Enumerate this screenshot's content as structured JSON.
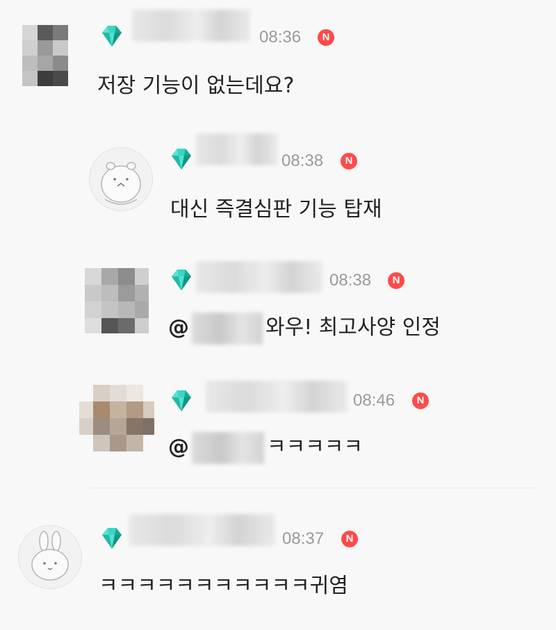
{
  "comments": [
    {
      "time": "08:36",
      "badge": "N",
      "text": "저장 기능이 없는데요?"
    },
    {
      "time": "08:38",
      "badge": "N",
      "text": "대신 즉결심판 기능 탑재"
    },
    {
      "time": "08:38",
      "badge": "N",
      "mention_prefix": "@",
      "text": "와우! 최고사양 인정"
    },
    {
      "time": "08:46",
      "badge": "N",
      "mention_prefix": "@",
      "text": "ㅋㅋㅋㅋㅋ"
    },
    {
      "time": "08:37",
      "badge": "N",
      "text": "ㅋㅋㅋㅋㅋㅋㅋㅋㅋㅋㅋ귀염"
    }
  ],
  "icons": {
    "level_badge": "diamond-icon",
    "new_badge": "new-badge-icon"
  },
  "colors": {
    "background": "#f8f8f8",
    "gem": "#1fc4b0",
    "new_badge": "#ff4a4a",
    "time": "#9a9a9a",
    "text": "#222222"
  }
}
